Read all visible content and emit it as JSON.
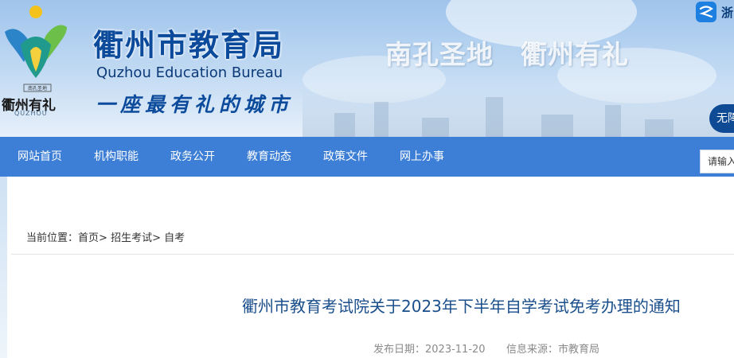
{
  "header": {
    "logo": {
      "text": "衢州有礼",
      "sub_text": "QUZHOU",
      "small_text": "南孔圣地"
    },
    "site_name": "衢州市教育局",
    "site_name_en": "Quzhou Education Bureau",
    "slogan": "一座最有礼的城市",
    "tagline": "南孔圣地　衢州有礼",
    "zj_badge_text": "浙",
    "accessibility_button": "无障"
  },
  "nav": {
    "items": [
      {
        "label": "网站首页"
      },
      {
        "label": "机构职能"
      },
      {
        "label": "政务公开"
      },
      {
        "label": "教育动态"
      },
      {
        "label": "政策文件"
      },
      {
        "label": "网上办事"
      }
    ],
    "search_placeholder": "请输入"
  },
  "breadcrumb": {
    "prefix": "当前位置：",
    "items": [
      "首页",
      "招生考试",
      "自考"
    ],
    "separator": ">"
  },
  "article": {
    "title": "衢州市教育考试院关于2023年下半年自学考试免考办理的通知",
    "publish_date_label": "发布日期：",
    "publish_date": "2023-11-20",
    "source_label": "信息来源：",
    "source": "市教育局"
  },
  "colors": {
    "nav_bg": "#3d7fd6",
    "brand_blue": "#0c4b9c",
    "title_blue": "#1a4f8c"
  }
}
